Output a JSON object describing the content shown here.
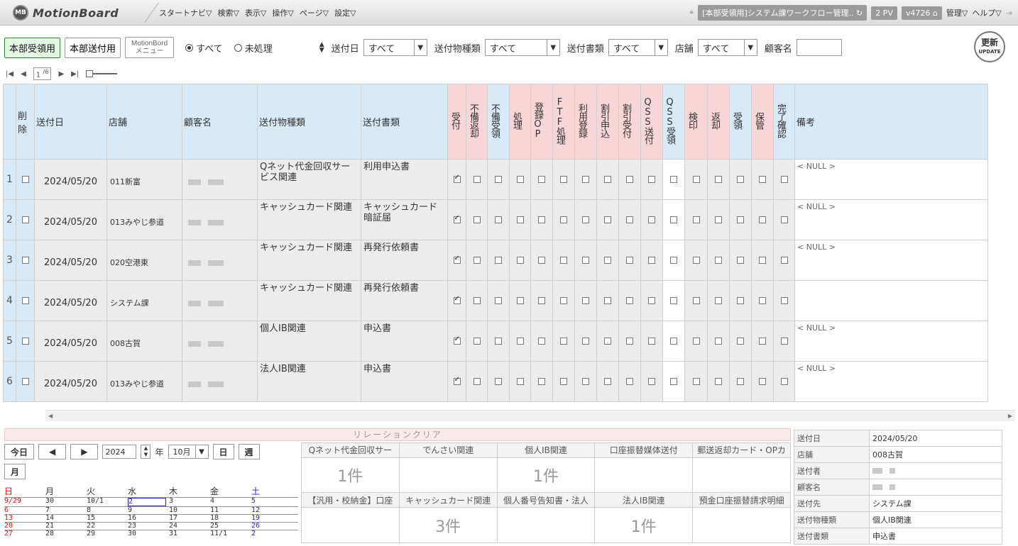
{
  "app": {
    "logo_badge": "MB",
    "logo_text": "MotionBoard",
    "menu": [
      "スタートナビ▽",
      "検索▽",
      "表示▽",
      "操作▽",
      "ページ▽",
      "設定▽"
    ],
    "board_title": "[本部受領用]システム課ワークフロー管理..",
    "pv": "2 PV",
    "version": "v4726",
    "manage": "管理▽",
    "help": "ヘルプ▽"
  },
  "filters": {
    "btn_receive": "本部受領用",
    "btn_send": "本部送付用",
    "btn_menu": "MotionBord\nメニュー",
    "radio_all": "すべて",
    "radio_unprocessed": "未処理",
    "send_date_label": "送付日",
    "send_date_value": "すべて",
    "item_type_label": "送付物種類",
    "item_type_value": "すべて",
    "doc_type_label": "送付書類",
    "doc_type_value": "すべて",
    "store_label": "店舗",
    "store_value": "すべて",
    "customer_label": "顧客名",
    "update_label": "更新",
    "update_sub": "UPDATE"
  },
  "pager": {
    "current": "1",
    "total": "/6"
  },
  "table": {
    "headers": {
      "delete": "削除",
      "send_date": "送付日",
      "store": "店舗",
      "customer": "顧客名",
      "item_type": "送付物種類",
      "doc_type": "送付書類",
      "flags": [
        "受付",
        "不備返却",
        "不備受領",
        "処理",
        "登録OP",
        "FTF処理",
        "利用登録",
        "割引申込",
        "割引受付",
        "QSS送付",
        "QSS受領",
        "検印",
        "返却",
        "受領",
        "保管",
        "完了確認"
      ],
      "note": "備考"
    },
    "rows": [
      {
        "num": "1",
        "date": "2024/05/20",
        "store": "011新富",
        "item": "Qネット代金回収サービス関連",
        "doc": "利用申込書",
        "note": "< NULL >"
      },
      {
        "num": "2",
        "date": "2024/05/20",
        "store": "013みやじ参道",
        "item": "キャッシュカード関連",
        "doc": "キャッシュカード暗証届",
        "note": "< NULL >"
      },
      {
        "num": "3",
        "date": "2024/05/20",
        "store": "020空港東",
        "item": "キャッシュカード関連",
        "doc": "再発行依頼書",
        "note": "< NULL >"
      },
      {
        "num": "4",
        "date": "2024/05/20",
        "store": "システム課",
        "item": "キャッシュカード関連",
        "doc": "再発行依頼書",
        "note": ""
      },
      {
        "num": "5",
        "date": "2024/05/20",
        "store": "008古賀",
        "item": "個人IB関連",
        "doc": "申込書",
        "note": "< NULL >"
      },
      {
        "num": "6",
        "date": "2024/05/20",
        "store": "013みやじ参道",
        "item": "法人IB関連",
        "doc": "申込書",
        "note": "< NULL >"
      }
    ]
  },
  "relation": {
    "title": "リレーションクリア",
    "row1": [
      {
        "label": "Qネット代金回収サー",
        "count": "1件"
      },
      {
        "label": "でんさい関連",
        "count": ""
      },
      {
        "label": "個人IB関連",
        "count": "1件"
      },
      {
        "label": "口座振替媒体送付",
        "count": ""
      },
      {
        "label": "郵送返却カード・OPカ",
        "count": ""
      }
    ],
    "row2": [
      {
        "label": "【汎用・校納金】口座",
        "count": ""
      },
      {
        "label": "キャッシュカード関連",
        "count": "3件"
      },
      {
        "label": "個人番号告知書・法人",
        "count": ""
      },
      {
        "label": "法人IB関連",
        "count": "1件"
      },
      {
        "label": "預金口座振替請求明細",
        "count": ""
      }
    ]
  },
  "calendar": {
    "today": "今日",
    "year": "2024",
    "year_suffix": "年",
    "month": "10月",
    "day_btn": "日",
    "week_btn": "週",
    "month_btn": "月",
    "weekdays": [
      "日",
      "月",
      "火",
      "水",
      "木",
      "金",
      "土"
    ],
    "weeks": [
      [
        "9/29",
        "30",
        "10/1",
        "2",
        "3",
        "4",
        "5"
      ],
      [
        "6",
        "7",
        "8",
        "9",
        "10",
        "11",
        "12"
      ],
      [
        "13",
        "14",
        "15",
        "16",
        "17",
        "18",
        "19"
      ],
      [
        "20",
        "21",
        "22",
        "23",
        "24",
        "25",
        "26"
      ],
      [
        "27",
        "28",
        "29",
        "30",
        "31",
        "11/1",
        "2"
      ]
    ]
  },
  "detail": [
    {
      "key": "送付日",
      "value": "2024/05/20"
    },
    {
      "key": "店舗",
      "value": "008古賀"
    },
    {
      "key": "送付者",
      "value": ""
    },
    {
      "key": "顧客名",
      "value": ""
    },
    {
      "key": "送付先",
      "value": "システム課"
    },
    {
      "key": "送付物種類",
      "value": "個人IB関連"
    },
    {
      "key": "送付書類",
      "value": "申込書"
    }
  ]
}
